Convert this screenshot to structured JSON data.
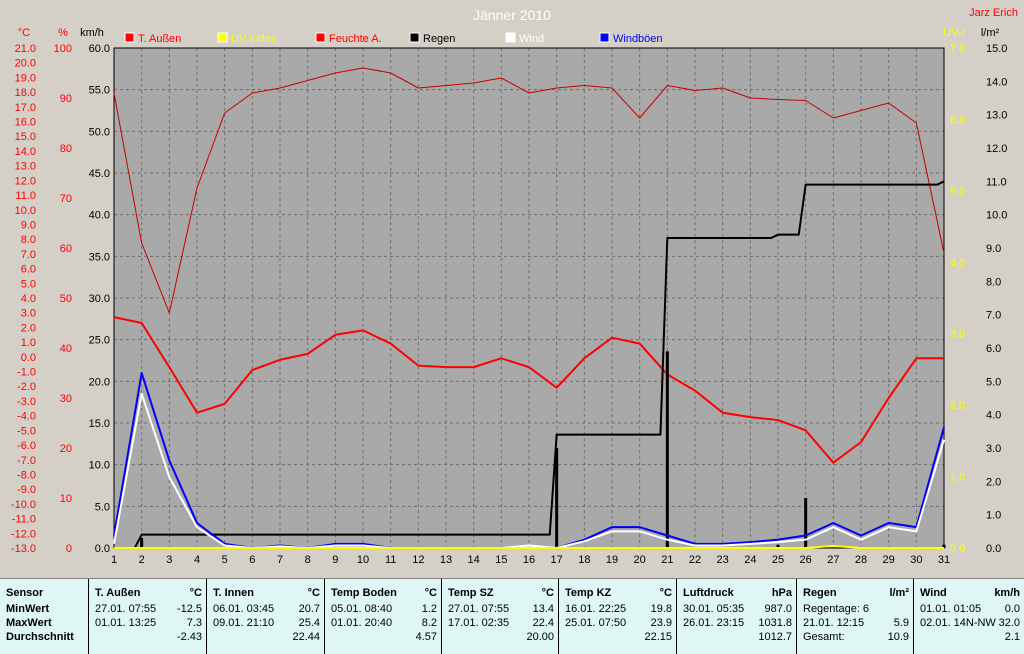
{
  "chart_data": {
    "type": "line",
    "title": "Jänner 2010",
    "station": "Jarz Erich",
    "x": [
      1,
      2,
      3,
      4,
      5,
      6,
      7,
      8,
      9,
      10,
      11,
      12,
      13,
      14,
      15,
      16,
      17,
      18,
      19,
      20,
      21,
      22,
      23,
      24,
      25,
      26,
      27,
      28,
      29,
      30,
      31
    ],
    "legend": [
      {
        "name": "T. Außen",
        "color": "#ff0000"
      },
      {
        "name": "UV Index",
        "color": "#ffff00"
      },
      {
        "name": "Feuchte A.",
        "color": "#ff0000"
      },
      {
        "name": "Regen",
        "color": "#000000"
      },
      {
        "name": "Wind",
        "color": "#ffffff"
      },
      {
        "name": "Windböen",
        "color": "#0000ff"
      }
    ],
    "axes": {
      "temp": {
        "unit": "°C",
        "min": -13.0,
        "max": 21.0,
        "step": 1.0,
        "color": "#ff0000"
      },
      "humidity": {
        "unit": "%",
        "min": 0,
        "max": 100,
        "step": 10,
        "color": "#ff0000"
      },
      "wind": {
        "unit": "km/h",
        "min": 0,
        "max": 60,
        "step": 5,
        "color": "#000000"
      },
      "uv": {
        "unit": "UV-I",
        "min": 0,
        "max": 7,
        "step": 1,
        "color": "#ffff00"
      },
      "rain": {
        "unit": "l/m²",
        "min": 0,
        "max": 15,
        "step": 1,
        "color": "#000000"
      }
    },
    "series": [
      {
        "name": "Feuchte A.",
        "axis": "humidity",
        "color": "#c80000",
        "width": 1,
        "values": [
          91,
          61,
          47,
          72,
          87,
          91,
          92,
          93.5,
          95,
          96,
          95,
          92,
          92.5,
          93,
          94,
          91,
          92,
          92.5,
          92,
          86,
          92.5,
          91.5,
          92,
          90,
          89.7,
          89.5,
          86,
          87.5,
          89,
          85,
          59
        ]
      },
      {
        "name": "T. Außen",
        "axis": "temp",
        "color": "#ff0000",
        "width": 2,
        "values": [
          2.7,
          2.3,
          -0.7,
          -3.8,
          -3.2,
          -0.9,
          -0.2,
          0.2,
          1.5,
          1.8,
          0.9,
          -0.6,
          -0.7,
          -0.7,
          -0.1,
          -0.7,
          -2.1,
          -0.1,
          1.3,
          0.9,
          -1.2,
          -2.3,
          -3.8,
          -4.1,
          -4.3,
          -5.0,
          -7.2,
          -5.8,
          -2.8,
          -0.1,
          -0.1
        ]
      },
      {
        "name": "Regen",
        "axis": "rain",
        "color": "#000000",
        "width": 2,
        "step": true,
        "values": [
          0,
          0.4,
          0.4,
          0.4,
          0.4,
          0.4,
          0.4,
          0.4,
          0.4,
          0.4,
          0.4,
          0.4,
          0.4,
          0.4,
          0.4,
          0.4,
          3.4,
          3.4,
          3.4,
          3.4,
          9.3,
          9.3,
          9.3,
          9.3,
          9.4,
          10.9,
          10.9,
          10.9,
          10.9,
          10.9,
          11.0
        ]
      },
      {
        "name": "Regen täglich",
        "axis": "rain",
        "color": "#000000",
        "width": 3,
        "bars": true,
        "values": [
          0,
          0.3,
          0,
          0,
          0,
          0,
          0,
          0,
          0,
          0,
          0,
          0,
          0,
          0,
          0,
          0,
          3.0,
          0,
          0,
          0,
          5.9,
          0,
          0,
          0,
          0.1,
          1.5,
          0,
          0,
          0,
          0,
          0.1
        ]
      },
      {
        "name": "Windböen",
        "axis": "wind",
        "color": "#0000ff",
        "width": 2,
        "values": [
          1.5,
          21,
          10.5,
          3,
          0.5,
          0,
          0.3,
          0,
          0.5,
          0.5,
          0,
          0,
          0,
          0,
          0,
          0,
          0,
          1,
          2.5,
          2.5,
          1.5,
          0.5,
          0.5,
          0.7,
          1,
          1.5,
          3,
          1.5,
          3,
          2.5,
          14.5
        ]
      },
      {
        "name": "Wind",
        "axis": "wind",
        "color": "#ffffff",
        "width": 2,
        "values": [
          0.5,
          18.5,
          8.5,
          2.5,
          0.3,
          0,
          0.2,
          0,
          0.3,
          0.3,
          0,
          0,
          0,
          0,
          0,
          0.3,
          0,
          0.8,
          2,
          2,
          1,
          0.3,
          0.3,
          0.5,
          0.7,
          1,
          2.5,
          1,
          2.5,
          2,
          13
        ]
      },
      {
        "name": "UV Index",
        "axis": "uv",
        "color": "#ffff00",
        "width": 2,
        "values": [
          0,
          0,
          0,
          0,
          0,
          0,
          0,
          0,
          0,
          0,
          0,
          0,
          0,
          0,
          0,
          0,
          0,
          0,
          0,
          0,
          0,
          0,
          0,
          0,
          0,
          0,
          0.03,
          0,
          0,
          0,
          0
        ]
      }
    ]
  },
  "stats": {
    "columns": [
      {
        "title": "Sensor",
        "unit": "",
        "rows": [
          [
            "MinWert",
            ""
          ],
          [
            "MaxWert",
            ""
          ],
          [
            "Durchschnitt",
            ""
          ]
        ]
      },
      {
        "title": "T. Außen",
        "unit": "°C",
        "rows": [
          [
            "27.01.  07:55",
            "-12.5"
          ],
          [
            "01.01.  13:25",
            "7.3"
          ],
          [
            "",
            "-2.43"
          ]
        ]
      },
      {
        "title": "T. Innen",
        "unit": "°C",
        "rows": [
          [
            "06.01.  03:45",
            "20.7"
          ],
          [
            "09.01.  21:10",
            "25.4"
          ],
          [
            "",
            "22.44"
          ]
        ]
      },
      {
        "title": "Temp Boden",
        "unit": "°C",
        "rows": [
          [
            "05.01.  08:40",
            "1.2"
          ],
          [
            "01.01.  20:40",
            "8.2"
          ],
          [
            "",
            "4.57"
          ]
        ]
      },
      {
        "title": "Temp SZ",
        "unit": "°C",
        "rows": [
          [
            "27.01.  07:55",
            "13.4"
          ],
          [
            "17.01.  02:35",
            "22.4"
          ],
          [
            "",
            "20.00"
          ]
        ]
      },
      {
        "title": "Temp KZ",
        "unit": "°C",
        "rows": [
          [
            "16.01.  22:25",
            "19.8"
          ],
          [
            "25.01.  07:50",
            "23.9"
          ],
          [
            "",
            "22.15"
          ]
        ]
      },
      {
        "title": "Luftdruck",
        "unit": "hPa",
        "rows": [
          [
            "30.01.  05:35",
            "987.0"
          ],
          [
            "26.01.  23:15",
            "1031.8"
          ],
          [
            "",
            "1012.7"
          ]
        ]
      },
      {
        "title": "Regen",
        "unit": "l/m²",
        "rows": [
          [
            "Regentage: 6",
            ""
          ],
          [
            "21.01.  12:15",
            "5.9"
          ],
          [
            "Gesamt:",
            "10.9"
          ]
        ]
      },
      {
        "title": "Wind",
        "unit": "km/h",
        "rows": [
          [
            "01.01.  01:05",
            "0.0"
          ],
          [
            "02.01.  14N-NW",
            "32.0"
          ],
          [
            "",
            "2.1"
          ]
        ]
      }
    ]
  }
}
